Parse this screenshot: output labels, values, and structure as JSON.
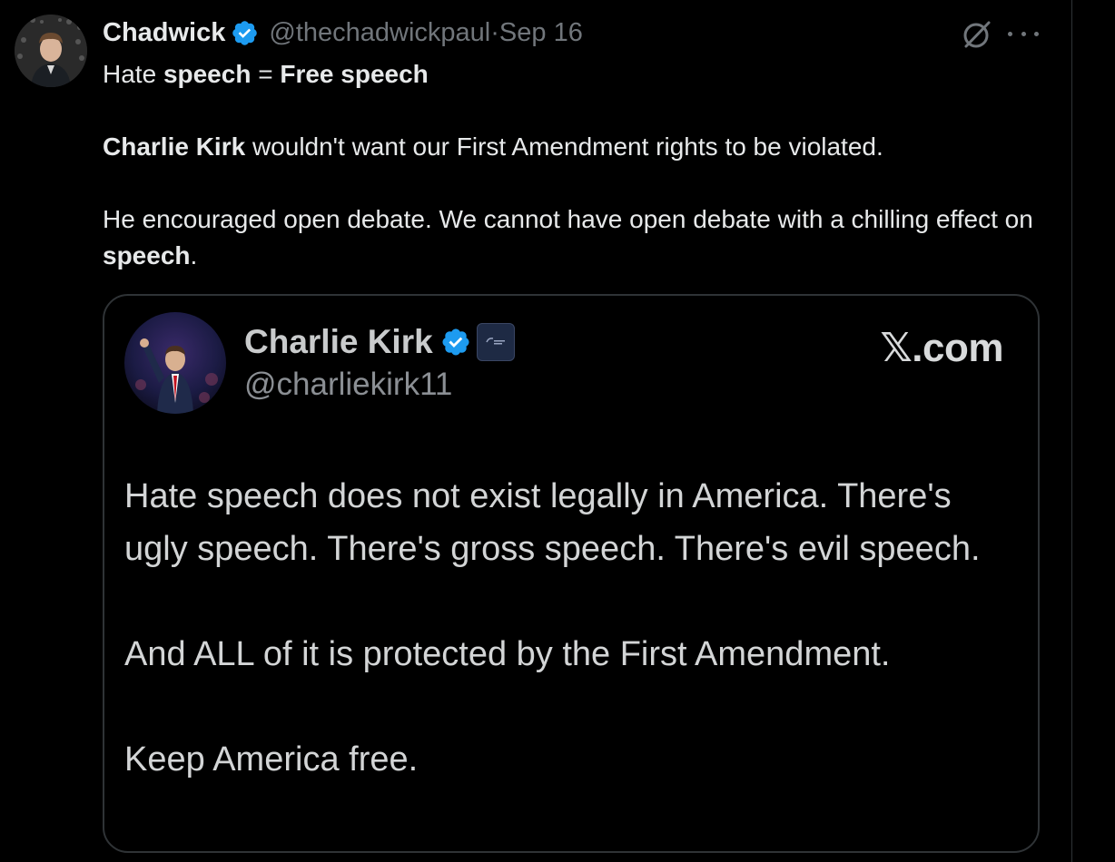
{
  "tweet": {
    "author_name": "Chadwick",
    "handle": "@thechadwickpaul",
    "separator": "·",
    "date": "Sep 16",
    "text": {
      "line1_a": "Hate ",
      "line1_b": "speech",
      "line1_c": " = ",
      "line1_d": "Free speech",
      "line2_a": "Charlie Kirk",
      "line2_b": " wouldn't want our First Amendment rights to be violated.",
      "line3_a": "He encouraged open debate. We cannot have open debate with a chilling effect on ",
      "line3_b": "speech",
      "line3_c": "."
    },
    "icons": {
      "avatar": "avatar",
      "verified": "verified-badge-icon",
      "grok": "grok-icon",
      "more": "more-options-icon"
    }
  },
  "quote": {
    "name": "Charlie Kirk",
    "handle": "@charliekirk11",
    "brand": "𝕏.com",
    "body": {
      "p1": "Hate speech does not exist legally in America. There's ugly speech. There's gross speech. There's evil speech.",
      "p2": "And ALL of it is protected by the First Amendment.",
      "p3": "Keep America free."
    }
  },
  "colors": {
    "background": "#000000",
    "text": "#e7e9ea",
    "muted": "#71767b",
    "verified": "#1d9bf0",
    "border": "#2f3336"
  }
}
